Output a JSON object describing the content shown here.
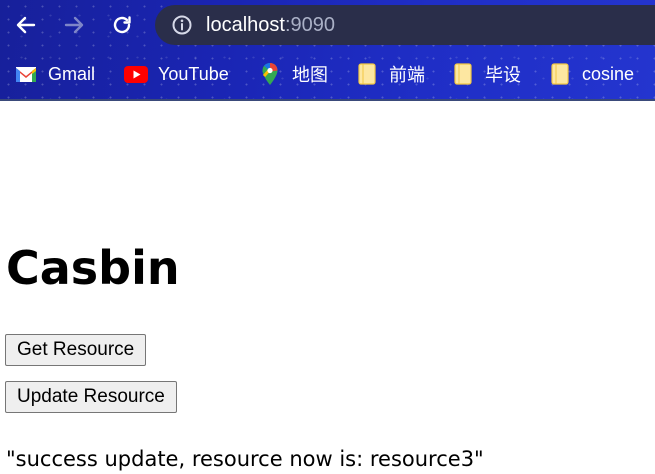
{
  "browser": {
    "address": {
      "host": "localhost",
      "port": ":9090"
    },
    "bookmarks": [
      {
        "label": "Gmail",
        "icon": "gmail-icon"
      },
      {
        "label": "YouTube",
        "icon": "youtube-icon"
      },
      {
        "label": "地图",
        "icon": "maps-pin-icon"
      },
      {
        "label": "前端",
        "icon": "folder-icon"
      },
      {
        "label": "毕设",
        "icon": "folder-icon"
      },
      {
        "label": "cosine",
        "icon": "folder-icon"
      }
    ]
  },
  "page": {
    "title": "Casbin",
    "get_button": "Get Resource",
    "update_button": "Update Resource",
    "result": "\"success update, resource now is: resource3\""
  },
  "colors": {
    "toolbar_bg": "#1a25b4",
    "omnibox_bg": "#2a2e4a",
    "button_bg": "#efefef",
    "button_border": "#767676"
  }
}
